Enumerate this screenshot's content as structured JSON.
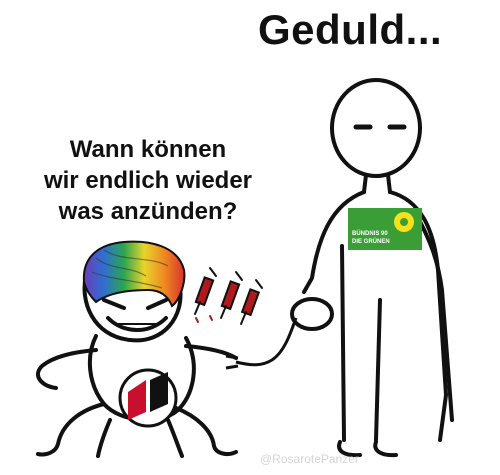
{
  "meme": {
    "title": "Geduld...",
    "speech_lines": [
      "Wann können",
      "wir endlich wieder",
      "was anzünden?"
    ],
    "watermark": "@RosarotePanzer",
    "badge_text": {
      "line1": "BÜNDNIS 90",
      "line2": "DIE GRÜNEN"
    }
  },
  "colors": {
    "ink": "#111111",
    "badge_green": "#3a9d35",
    "sunflower": "#f7e11b",
    "syringe_red": "#b01a1a",
    "emblem_red": "#c8102e",
    "watermark": "#d4d4d4"
  },
  "icons": {
    "badge": "green-party-sunflower-logo",
    "belly": "antifa-flag-emblem",
    "syringes": "syringe-icon"
  }
}
